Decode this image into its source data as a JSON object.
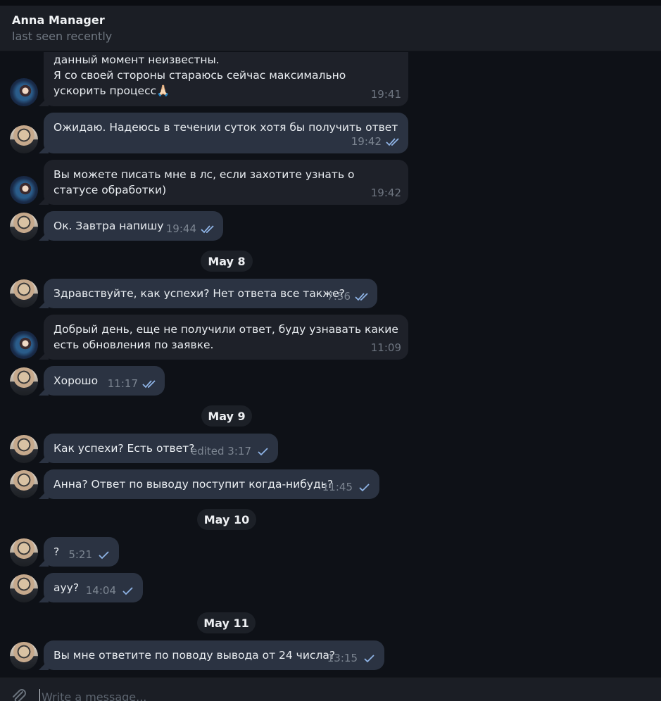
{
  "header": {
    "title": "Anna Manager",
    "status": "last seen recently"
  },
  "messages": [
    {
      "text": "данный момент неизвестны.\nЯ со своей стороны стараюсь сейчас максимально ускорить процесс🙏🏻",
      "time": "19:41"
    },
    {
      "text": "Ожидаю. Надеюсь в течении суток хотя бы получить ответ",
      "time": "19:42"
    },
    {
      "text": "Вы можете писать мне в лс, если захотите узнать о статусе обработки)",
      "time": "19:42"
    },
    {
      "text": "Ок. Завтра напишу",
      "time": "19:44"
    },
    {
      "text": "Здравствуйте, как успехи? Нет ответа все также?",
      "time": "7:56"
    },
    {
      "text": "Добрый день, еще не получили ответ, буду узнавать какие есть обновления по заявке.",
      "time": "11:09"
    },
    {
      "text": "Хорошо",
      "time": "11:17"
    },
    {
      "text": "Как успехи? Есть ответ?",
      "time": "edited 3:17"
    },
    {
      "text": "Анна? Ответ по выводу поступит когда-нибудь?",
      "time": "11:45"
    },
    {
      "text": "?",
      "time": "5:21"
    },
    {
      "text": "ауу?",
      "time": "14:04"
    },
    {
      "text": "Вы мне ответите по поводу вывода от 24 числа?",
      "time": "13:15"
    }
  ],
  "dates": [
    "May 8",
    "May 9",
    "May 10",
    "May 11"
  ],
  "composer": {
    "placeholder": "Write a message..."
  },
  "colors": {
    "incoming_bubble": "#1e2129",
    "outgoing_bubble": "#2b3342",
    "read_check": "#8fb4e6"
  }
}
